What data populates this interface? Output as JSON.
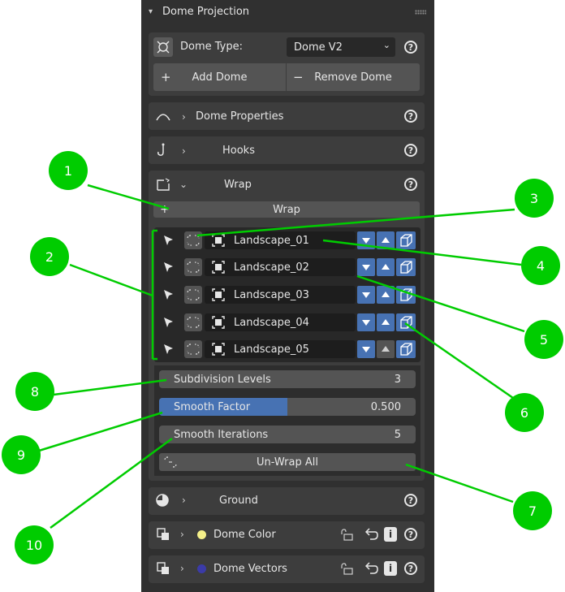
{
  "panel": {
    "title": "Dome Projection",
    "dome_type_label": "Dome Type:",
    "dome_type_value": "Dome V2",
    "add_dome": "Add Dome",
    "remove_dome": "Remove Dome",
    "add_symbol": "+",
    "remove_symbol": "−",
    "question": "?"
  },
  "sections": {
    "dome_properties": "Dome Properties",
    "hooks": "Hooks",
    "wrap": "Wrap",
    "ground": "Ground",
    "dome_color": "Dome Color",
    "dome_vectors": "Dome Vectors"
  },
  "wrap": {
    "wrap_button": "Wrap",
    "landscapes": [
      "Landscape_01",
      "Landscape_02",
      "Landscape_03",
      "Landscape_04",
      "Landscape_05"
    ],
    "subdivision_label": "Subdivision Levels",
    "subdivision_value": "3",
    "smooth_factor_label": "Smooth Factor",
    "smooth_factor_value": "0.500",
    "smooth_factor_fraction": 0.5,
    "smooth_iterations_label": "Smooth Iterations",
    "smooth_iterations_value": "5",
    "unwrap_all": "Un-Wrap All"
  },
  "colors": {
    "callout": "#00cc00",
    "accent_blue": "#4772b3",
    "dome_color_dot": "#f5f08a",
    "dome_vectors_dot": "#3b3ba8"
  },
  "callouts": [
    "1",
    "2",
    "3",
    "4",
    "5",
    "6",
    "7",
    "8",
    "9",
    "10"
  ]
}
